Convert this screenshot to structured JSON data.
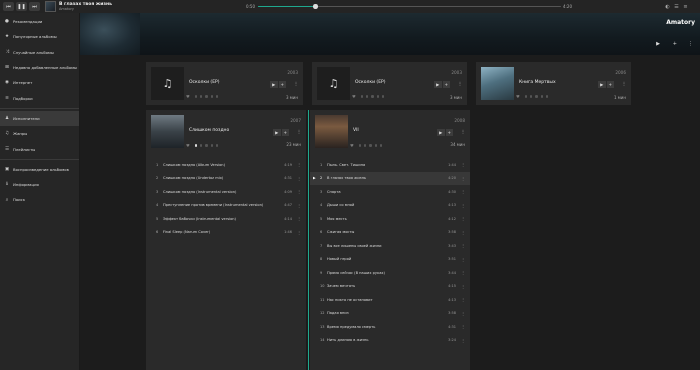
{
  "player": {
    "title": "В глазах твоя жизнь",
    "artist": "Amatory",
    "current_time": "0:50",
    "total_time": "4:20",
    "progress": 0.19,
    "controls": [
      "prev-icon",
      "pause-icon",
      "next-icon"
    ],
    "accent_color": "#1fa88e"
  },
  "sidebar": {
    "items": [
      {
        "label": "Рекомендации",
        "icon": "lightbulb-icon",
        "glyph": "●"
      },
      {
        "label": "Популярные альбомы",
        "icon": "star-icon",
        "glyph": "★"
      },
      {
        "label": "Случайные альбомы",
        "icon": "shuffle-icon",
        "glyph": "⤨"
      },
      {
        "label": "Недавно добавленные альбомы",
        "icon": "plus-box-icon",
        "glyph": "⊞"
      },
      {
        "label": "Интернет",
        "icon": "radio-icon",
        "glyph": "◉"
      },
      {
        "label": "Подборки",
        "icon": "playlist-icon",
        "glyph": "≡"
      },
      {
        "label": "Исполнители",
        "icon": "person-icon",
        "glyph": "♟",
        "active": true
      },
      {
        "label": "Жанры",
        "icon": "genre-icon",
        "glyph": "♫"
      },
      {
        "label": "Плейлисты",
        "icon": "playlists-icon",
        "glyph": "☰"
      },
      {
        "label": "Воспроизведение альбомов",
        "icon": "album-play-icon",
        "glyph": "▣"
      },
      {
        "label": "Информация",
        "icon": "info-icon",
        "glyph": "ℹ"
      },
      {
        "label": "Поиск",
        "icon": "search-icon",
        "glyph": "⌕"
      }
    ]
  },
  "header": {
    "artist_name": "Amatory"
  },
  "albums": [
    {
      "title": "Осколки (EP)",
      "year": "2003",
      "duration": "3 мин",
      "rating": 0
    },
    {
      "title": "Осколки (EP)",
      "year": "2003",
      "duration": "3 мин",
      "rating": 0
    },
    {
      "title": "Книга Мертвых",
      "year": "2006",
      "duration": "1 мин",
      "rating": 0
    },
    {
      "title": "Слишком поздно",
      "year": "2007",
      "duration": "23 мин",
      "rating": 1,
      "tracks": [
        {
          "num": "1",
          "name": "Слишком поздно (Album Version)",
          "dur": "4:19"
        },
        {
          "num": "2",
          "name": "Слишком поздно (Undertoz mix)",
          "dur": "4:31"
        },
        {
          "num": "3",
          "name": "Слишком поздно (Instrumental version)",
          "dur": "4:09"
        },
        {
          "num": "4",
          "name": "Преступление против времени (Instrumental version)",
          "dur": "4:47"
        },
        {
          "num": "5",
          "name": "Эффект бабочки (Instrumental version)",
          "dur": "4:14"
        },
        {
          "num": "6",
          "name": "Final Sleep (Narum Cover)",
          "dur": "1:46"
        }
      ]
    },
    {
      "title": "VII",
      "year": "2008",
      "duration": "34 мин",
      "rating": 0,
      "tracks": [
        {
          "num": "1",
          "name": "Пыль. Свет. Тишина",
          "dur": "1:44"
        },
        {
          "num": "2",
          "name": "В глазах твоя жизнь",
          "dur": "4:20",
          "playing": true
        },
        {
          "num": "3",
          "name": "Спарта",
          "dur": "4:30"
        },
        {
          "num": "4",
          "name": "Дыши со мной",
          "dur": "4:13"
        },
        {
          "num": "5",
          "name": "Моя месть",
          "dur": "4:12"
        },
        {
          "num": "6",
          "name": "Сжигая мосты",
          "dur": "3:58"
        },
        {
          "num": "7",
          "name": "Вы все лишены своей жизни",
          "dur": "3:43"
        },
        {
          "num": "8",
          "name": "Новый герой",
          "dur": "3:51"
        },
        {
          "num": "9",
          "name": "Прямо сейчас (В наших руках)",
          "dur": "3:44"
        },
        {
          "num": "10",
          "name": "Зачем мечтать",
          "dur": "4:15"
        },
        {
          "num": "11",
          "name": "Нас никто не остановит",
          "dur": "4:13"
        },
        {
          "num": "12",
          "name": "Падая вниз",
          "dur": "3:58"
        },
        {
          "num": "13",
          "name": "Время предумало смерть",
          "dur": "4:31"
        },
        {
          "num": "14",
          "name": "Нить длиною в жизнь",
          "dur": "3:24"
        }
      ]
    }
  ]
}
